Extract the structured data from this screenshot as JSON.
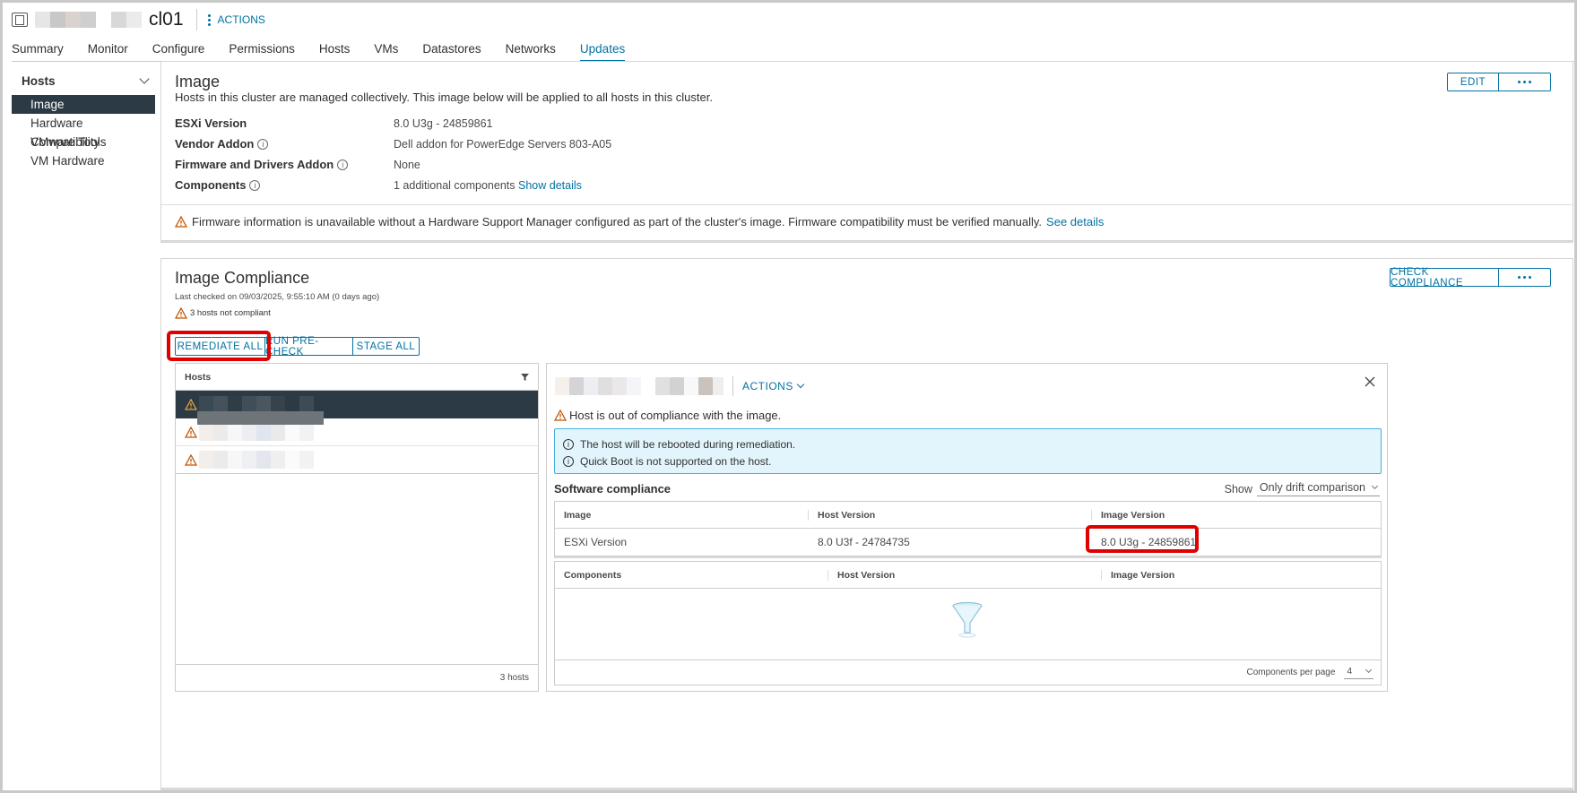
{
  "header": {
    "title": "cl01",
    "actions_label": "ACTIONS"
  },
  "tabs": [
    {
      "label": "Summary"
    },
    {
      "label": "Monitor"
    },
    {
      "label": "Configure"
    },
    {
      "label": "Permissions"
    },
    {
      "label": "Hosts"
    },
    {
      "label": "VMs"
    },
    {
      "label": "Datastores"
    },
    {
      "label": "Networks"
    },
    {
      "label": "Updates",
      "active": true
    }
  ],
  "sidebar": {
    "section": "Hosts",
    "items": [
      {
        "label": "Image",
        "active": true
      },
      {
        "label": "Hardware Compatibility"
      },
      {
        "label": "VMware Tools"
      },
      {
        "label": "VM Hardware"
      }
    ]
  },
  "image_card": {
    "title": "Image",
    "description": "Hosts in this cluster are managed collectively. This image below will be applied to all hosts in this cluster.",
    "edit_label": "EDIT",
    "rows": [
      {
        "key": "ESXi Version",
        "value": "8.0 U3g - 24859861",
        "info": false
      },
      {
        "key": "Vendor Addon",
        "value": "Dell addon for PowerEdge Servers 803-A05",
        "info": true
      },
      {
        "key": "Firmware and Drivers Addon",
        "value": "None",
        "info": true
      },
      {
        "key": "Components",
        "value": "1 additional components",
        "link": "Show details",
        "info": true
      }
    ],
    "warning": "Firmware information is unavailable without a Hardware Support Manager configured as part of the cluster's image. Firmware compatibility must be verified manually.",
    "warning_link": "See details"
  },
  "compliance_card": {
    "title": "Image Compliance",
    "check_label": "CHECK COMPLIANCE",
    "last_checked": "Last checked on 09/03/2025, 9:55:10 AM (0 days ago)",
    "not_compliant": "3 hosts not compliant",
    "buttons": {
      "remediate": "REMEDIATE ALL",
      "precheck": "RUN PRE-CHECK",
      "stage": "STAGE ALL"
    },
    "hosts_grid": {
      "header": "Hosts",
      "footer": "3 hosts"
    },
    "detail": {
      "actions_label": "ACTIONS",
      "status": "Host is out of compliance with the image.",
      "info_lines": [
        "The host will be rebooted during remediation.",
        "Quick Boot is not supported on the host."
      ],
      "software_title": "Software compliance",
      "show_label": "Show",
      "show_value": "Only drift comparison",
      "image_table": {
        "headers": [
          "Image",
          "Host Version",
          "Image Version"
        ],
        "rows": [
          {
            "name": "ESXi Version",
            "host": "8.0 U3f - 24784735",
            "image": "8.0 U3g - 24859861"
          }
        ]
      },
      "components_table": {
        "headers": [
          "Components",
          "Host Version",
          "Image Version"
        ],
        "per_page_label": "Components per page",
        "per_page_value": "4"
      }
    }
  },
  "colors": {
    "accent": "#0072a3",
    "warning": "#c25400",
    "sidebar_active": "#2b3a44",
    "highlight": "#e00000"
  }
}
